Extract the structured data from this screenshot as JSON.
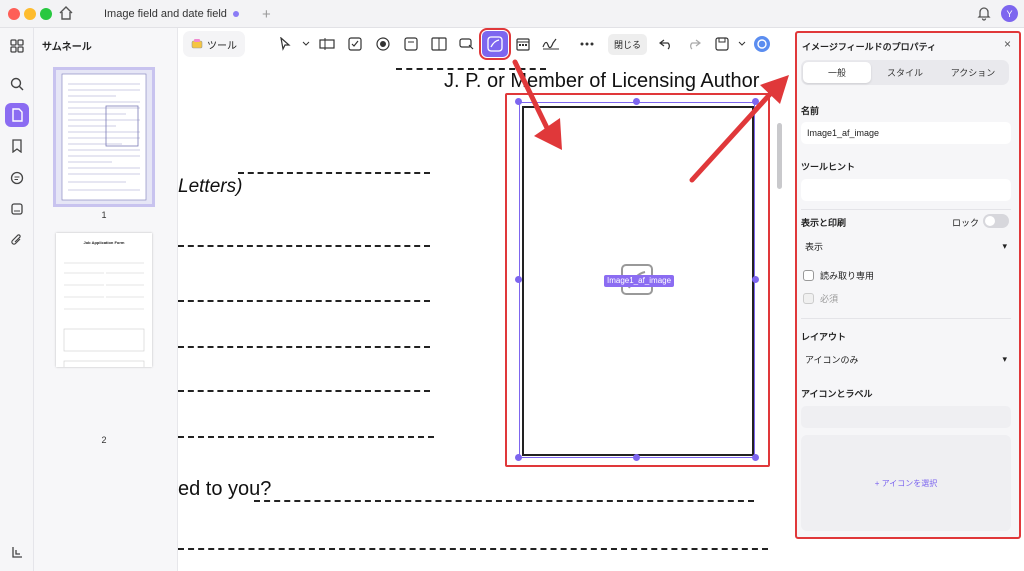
{
  "titlebar": {
    "tab_title": "Image field and date field",
    "plus": "+",
    "avatar": "Y"
  },
  "thumbnails": {
    "title": "サムネール",
    "pages": [
      {
        "num": "1"
      },
      {
        "num": "2"
      }
    ],
    "page2_heading": "Job Application Form"
  },
  "toolbar": {
    "tool_label": "ツール",
    "close_label": "閉じる"
  },
  "document": {
    "licensing": "J. P. or Member of Licensing Author",
    "letters": "Letters)",
    "addressed": "ed to you?",
    "field_name": "Image1_af_image"
  },
  "panel": {
    "title": "イメージフィールドのプロパティ",
    "close": "×",
    "tabs": [
      {
        "label": "一般"
      },
      {
        "label": "スタイル"
      },
      {
        "label": "アクション"
      }
    ],
    "name_label": "名前",
    "name_value": "Image1_af_image",
    "tooltip_label": "ツールヒント",
    "tooltip_value": "",
    "display_label": "表示と印刷",
    "lock_label": "ロック",
    "display_value": "表示",
    "readonly_label": "読み取り専用",
    "required_label": "必須",
    "layout_label": "レイアウト",
    "layout_value": "アイコンのみ",
    "icon_label_heading": "アイコンとラベル",
    "icon_label_value": "",
    "select_icon": "+ アイコンを選択",
    "caret": "▾"
  },
  "colors": {
    "accent": "#7d66ef",
    "highlight": "#e0383a"
  }
}
